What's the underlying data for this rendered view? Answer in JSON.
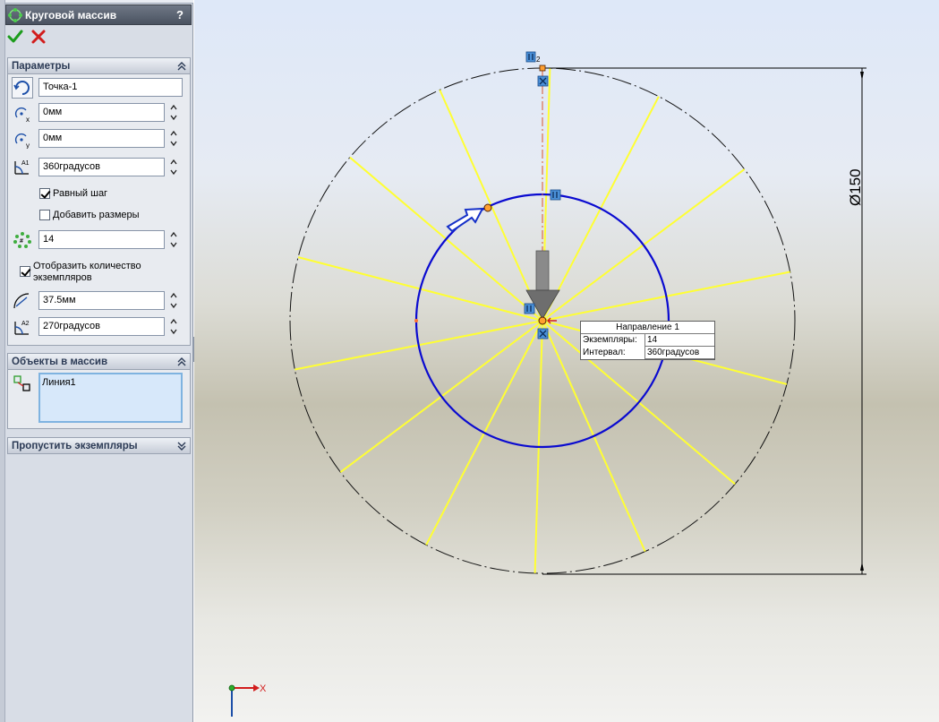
{
  "property_manager": {
    "title": "Круговой массив",
    "help_label": "?",
    "parameters": {
      "header": "Параметры",
      "center_point": "Точка-1",
      "center_x": "0мм",
      "center_y": "0мм",
      "angle": "360градусов",
      "equal_spacing_label": "Равный шаг",
      "equal_spacing_checked": true,
      "add_dimensions_label": "Добавить размеры",
      "add_dimensions_checked": false,
      "instances": "14",
      "show_count_label_line1": "Отобразить количество",
      "show_count_label_line2": "экземпляров",
      "show_count_checked": true,
      "radius": "37.5мм",
      "arc_angle": "270градусов"
    },
    "entities": {
      "header": "Объекты в массив",
      "items": [
        "Линия1"
      ]
    },
    "skip": {
      "header": "Пропустить экземпляры"
    }
  },
  "viewport": {
    "dimension_label": "Ø150",
    "tooltip": {
      "title": "Направление 1",
      "instances_label": "Экземпляры:",
      "instances_value": "14",
      "spacing_label": "Интервал:",
      "spacing_value": "360градусов"
    },
    "triad_x_label": "X",
    "point_sub_label": "2",
    "colors": {
      "pattern_lines": "#ffff33",
      "circle_path": "#0000cc",
      "outer_circle": "#000000"
    }
  }
}
